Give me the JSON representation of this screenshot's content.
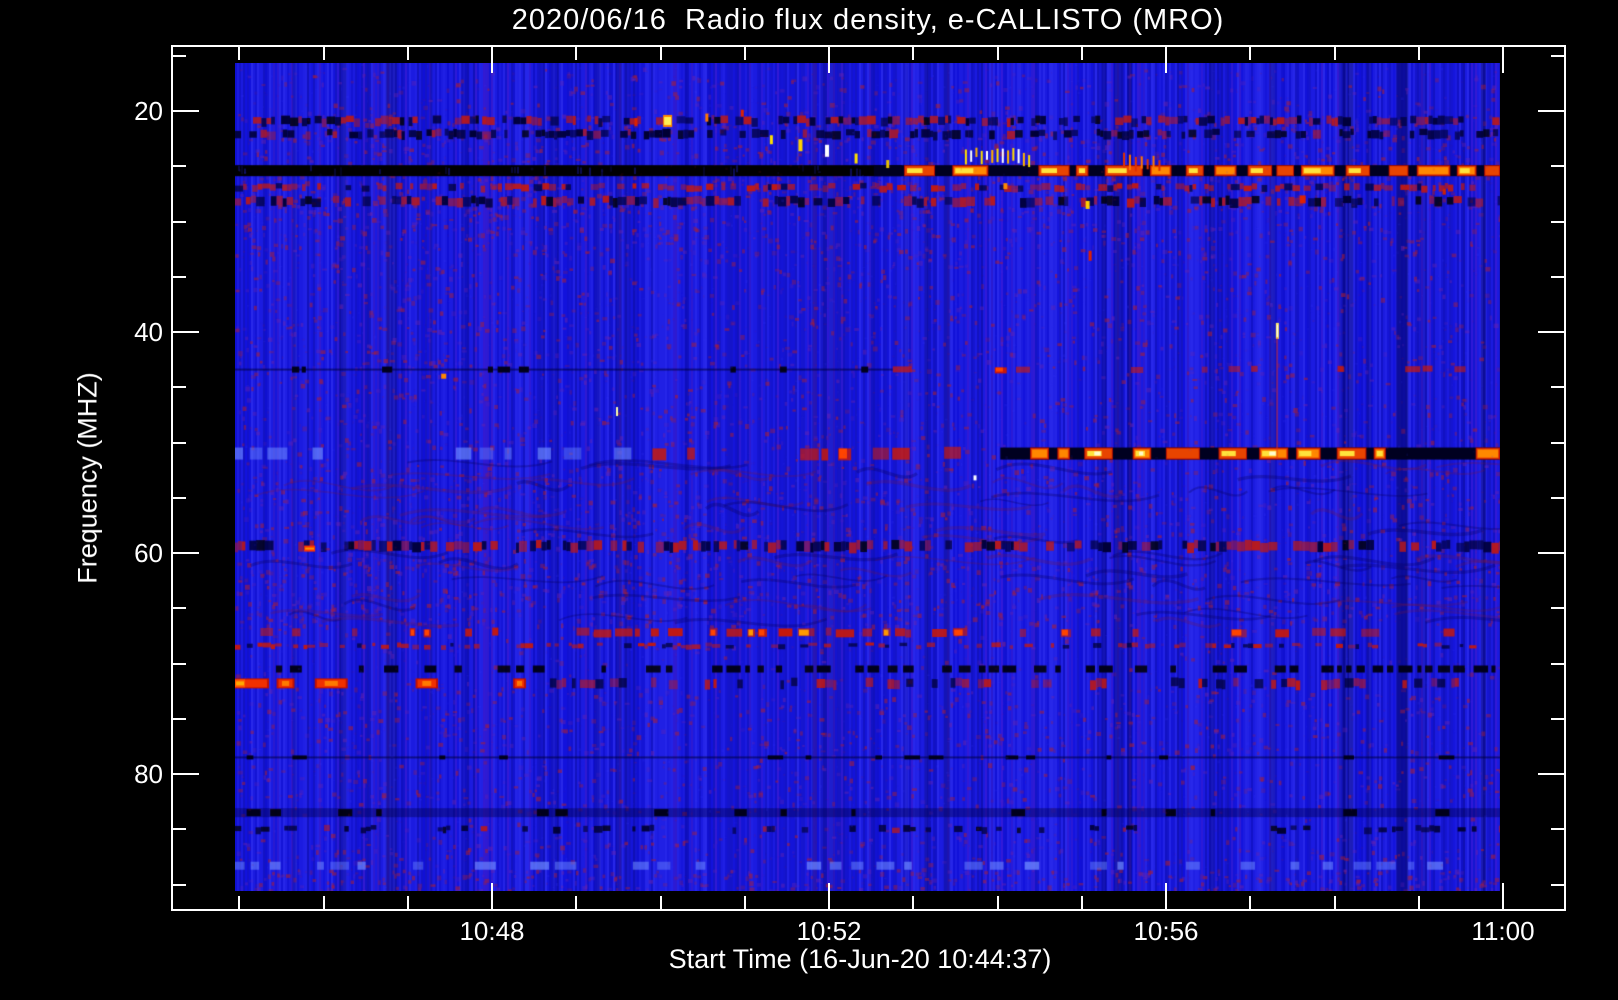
{
  "chart_data": {
    "type": "heatmap",
    "subtype": "radio-spectrogram",
    "title": "2020/06/16  Radio flux density, e-CALLISTO (MRO)",
    "xlabel": "Start Time (16-Jun-20 10:44:37)",
    "ylabel": "Frequency (MHZ)",
    "x_axis": {
      "tick_labels": [
        "10:48",
        "10:52",
        "10:56",
        "11:00"
      ],
      "tick_minutes": [
        48,
        52,
        56,
        60
      ],
      "window_minutes": [
        45,
        60
      ],
      "minor_step_minutes": 1,
      "start_time_label": "10:44:37"
    },
    "y_axis": {
      "tick_values": [
        20,
        40,
        60,
        80
      ],
      "minor_step": 5,
      "range_mhz": [
        15.7,
        90.5
      ],
      "inverted": true
    },
    "palette": {
      "background": "#000000",
      "axis": "#ffffff",
      "base_blue": "#1b1be0",
      "stripe_dark": "#0d0dc0",
      "stripe_light": "#4646ff",
      "mottle_red": "#a02040",
      "mottle_purple": "#6a22a8",
      "hot_red": "#cc1100",
      "hot_orange": "#ff8800",
      "hot_yellow": "#ffe33c",
      "hot_white": "#ffffff",
      "line_black": "#000002",
      "line_navy": "#000050"
    },
    "rfi_lines": [
      {
        "f": 20.9,
        "h": 9,
        "segments": [
          {
            "t0": 0,
            "t1": 1,
            "style": "speckle_mixed"
          }
        ]
      },
      {
        "f": 22.1,
        "h": 9,
        "segments": [
          {
            "t0": 0,
            "t1": 1,
            "style": "speckle_dark"
          }
        ]
      },
      {
        "f": 25.4,
        "h": 11,
        "segments": [
          {
            "t0": 0,
            "t1": 0.527,
            "style": "black_solid"
          },
          {
            "t0": 0.505,
            "t1": 1,
            "style": "bright_hot"
          }
        ]
      },
      {
        "f": 26.9,
        "h": 7,
        "segments": [
          {
            "t0": 0,
            "t1": 1,
            "style": "speckle_red",
            "p": 0.5
          }
        ]
      },
      {
        "f": 28.2,
        "h": 10,
        "segments": [
          {
            "t0": 0,
            "t1": 1,
            "style": "speckle_mixed"
          }
        ]
      },
      {
        "f": 43.4,
        "h": 6,
        "segments": [
          {
            "t0": 0,
            "t1": 0.52,
            "style": "dark_thin"
          },
          {
            "t0": 0.52,
            "t1": 1,
            "style": "red_dashes",
            "p": 0.38
          }
        ]
      },
      {
        "f": 51.0,
        "h": 12,
        "segments": [
          {
            "t0": 0,
            "t1": 0.33,
            "style": "blue_light",
            "p": 0.4
          },
          {
            "t0": 0.33,
            "t1": 0.605,
            "style": "red_dashes",
            "p": 0.3
          },
          {
            "t0": 0.605,
            "t1": 1,
            "style": "bright_hot"
          }
        ]
      },
      {
        "f": 59.4,
        "h": 11,
        "segments": [
          {
            "t0": 0,
            "t1": 1,
            "style": "speckle_mixed"
          }
        ]
      },
      {
        "f": 67.2,
        "h": 8,
        "segments": [
          {
            "t0": 0,
            "t1": 0.27,
            "style": "red_dashes",
            "p": 0.45
          },
          {
            "t0": 0.27,
            "t1": 0.53,
            "style": "red_dashes",
            "p": 0.88,
            "bright": true
          },
          {
            "t0": 0.53,
            "t1": 1,
            "style": "red_dashes",
            "p": 0.5
          }
        ]
      },
      {
        "f": 68.4,
        "h": 5,
        "segments": [
          {
            "t0": 0,
            "t1": 1,
            "style": "speckle_red",
            "p": 0.3
          }
        ]
      },
      {
        "f": 70.5,
        "h": 7,
        "segments": [
          {
            "t0": 0,
            "t1": 0.5,
            "style": "dark_dashes",
            "p": 0.5
          },
          {
            "t0": 0.5,
            "t1": 1,
            "style": "dark_dashes",
            "p": 0.72
          }
        ]
      },
      {
        "f": 71.8,
        "h": 10,
        "segments": [
          {
            "t0": 0,
            "t1": 0.23,
            "style": "bright_red"
          },
          {
            "t0": 0.23,
            "t1": 1,
            "style": "speckle_red",
            "p": 0.22
          }
        ]
      },
      {
        "f": 78.5,
        "h": 4,
        "segments": [
          {
            "t0": 0,
            "t1": 1,
            "style": "dark_thin"
          }
        ]
      },
      {
        "f": 83.5,
        "h": 9,
        "segments": [
          {
            "t0": 0,
            "t1": 1,
            "style": "dark_band"
          }
        ]
      },
      {
        "f": 85.0,
        "h": 7,
        "segments": [
          {
            "t0": 0,
            "t1": 1,
            "style": "speckle_dark",
            "p": 0.3
          }
        ]
      },
      {
        "f": 88.3,
        "h": 8,
        "segments": [
          {
            "t0": 0,
            "t1": 1,
            "style": "blue_light",
            "p": 0.55
          }
        ]
      }
    ],
    "events": [
      {
        "t": 0.317,
        "f": 21.0,
        "color": "#dd2200",
        "w": 3,
        "h": 8
      },
      {
        "t": 0.342,
        "f": 20.9,
        "color": "#ff8800",
        "core": "#ffee55",
        "w": 9,
        "h": 12
      },
      {
        "t": 0.373,
        "f": 20.6,
        "color": "#ff7700",
        "w": 3,
        "h": 8
      },
      {
        "t": 0.401,
        "f": 20.2,
        "color": "#dd2200",
        "w": 3,
        "h": 7
      },
      {
        "t": 0.424,
        "f": 22.6,
        "color": "#ffe000",
        "w": 3,
        "h": 9
      },
      {
        "t": 0.447,
        "f": 23.1,
        "color": "#ffd000",
        "w": 4,
        "h": 12
      },
      {
        "t": 0.468,
        "f": 23.6,
        "color": "#ffffff",
        "w": 4,
        "h": 12
      },
      {
        "t": 0.491,
        "f": 24.3,
        "color": "#ffe000",
        "w": 3,
        "h": 10
      },
      {
        "t": 0.516,
        "f": 24.8,
        "color": "#e8c000",
        "w": 3,
        "h": 8
      },
      {
        "type": "cluster",
        "t0": 0.577,
        "t1": 0.627,
        "f": 23.9,
        "count": 13,
        "colors": [
          "#ffe000",
          "#ffffff",
          "#ffb300"
        ],
        "drift": 4
      },
      {
        "type": "cluster",
        "t0": 0.702,
        "t1": 0.73,
        "f": 24.6,
        "count": 7,
        "colors": [
          "#e03000",
          "#ff7700"
        ],
        "drift": 3
      },
      {
        "t": 0.609,
        "f": 26.8,
        "color": "#ff8800",
        "w": 4,
        "h": 6
      },
      {
        "t": 0.674,
        "f": 28.5,
        "color": "#ffd000",
        "w": 4,
        "h": 8
      },
      {
        "t": 0.676,
        "f": 33.1,
        "color": "#dd2200",
        "w": 3,
        "h": 10
      },
      {
        "t": 0.844,
        "f": 28.0,
        "color": "#dd2200",
        "w": 6,
        "h": 8
      },
      {
        "t": 0.956,
        "f": 27.3,
        "color": "#cc2200",
        "w": 3,
        "h": 6
      },
      {
        "t": 0.165,
        "f": 44.0,
        "color": "#ff8800",
        "w": 5,
        "h": 5
      },
      {
        "t": 0.302,
        "f": 47.2,
        "color": "#ffffaa",
        "w": 2,
        "h": 9
      },
      {
        "t": 0.824,
        "f": 39.9,
        "color": "#ffee66",
        "core": "#ffffff",
        "w": 3,
        "h": 16
      },
      {
        "t": 0.585,
        "f": 53.2,
        "color": "#ffffff",
        "w": 3,
        "h": 5
      },
      {
        "t": 0.059,
        "f": 59.6,
        "color": "#ff3300",
        "core": "#ff9900",
        "w": 11,
        "h": 6
      },
      {
        "t": 0.004,
        "f": 71.8,
        "color": "#ff5500",
        "core": "#ffaa00",
        "w": 10,
        "h": 8
      },
      {
        "type": "vstreak",
        "t": 0.823,
        "f0": 40.5,
        "f1": 51.5,
        "color": "rgba(230,50,20,0.45)",
        "w": 2
      }
    ],
    "mottle_bands": [
      {
        "f0": 16.5,
        "f1": 20.3,
        "density": 0.5,
        "left_bias": 0.25
      },
      {
        "f0": 20.3,
        "f1": 29.0,
        "density": 1.2,
        "left_bias": 0.2
      },
      {
        "f0": 29.0,
        "f1": 33.0,
        "density": 1.6,
        "left_bias": 0.55
      },
      {
        "f0": 33.0,
        "f1": 44.0,
        "density": 0.8,
        "left_bias": 0.45
      },
      {
        "f0": 44.0,
        "f1": 50.5,
        "density": 0.7,
        "left_bias": 0.5
      },
      {
        "f0": 51.7,
        "f1": 58.8,
        "density": 1.1,
        "left_bias": 0.5,
        "wavy": true
      },
      {
        "f0": 59.9,
        "f1": 66.6,
        "density": 1.5,
        "left_bias": 0.45,
        "wavy": true
      },
      {
        "f0": 72.3,
        "f1": 78.0,
        "density": 0.9,
        "left_bias": 0.35
      },
      {
        "f0": 79.0,
        "f1": 83.0,
        "density": 0.7,
        "left_bias": 0.3
      },
      {
        "f0": 85.5,
        "f1": 87.8,
        "density": 0.8,
        "left_bias": 0.2
      },
      {
        "f0": 88.6,
        "f1": 90.5,
        "density": 1.8,
        "left_bias": 0.1
      }
    ],
    "dark_columns": [
      {
        "t": 0.918,
        "w": 12,
        "a": 0.3
      },
      {
        "t": 0.88,
        "w": 5,
        "a": 0.25
      },
      {
        "t": 0.695,
        "w": 4,
        "a": 0.25
      },
      {
        "t": 0.545,
        "w": 4,
        "a": 0.22
      },
      {
        "t": 0.985,
        "w": 5,
        "a": 0.28
      }
    ]
  }
}
